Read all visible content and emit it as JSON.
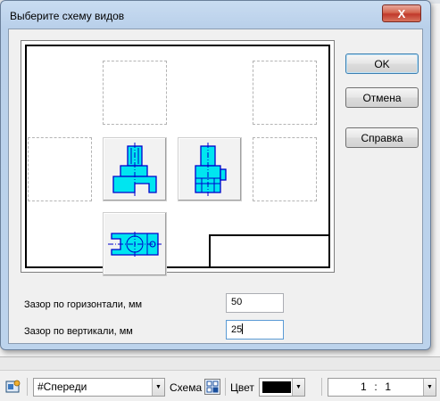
{
  "dialog": {
    "title": "Выберите схему видов",
    "close_label": "X",
    "buttons": {
      "ok": "OK",
      "cancel": "Отмена",
      "help": "Справка"
    },
    "gap_horizontal": {
      "label": "Зазор по горизонтали, мм",
      "value": "50"
    },
    "gap_vertical": {
      "label": "Зазор по вертикали, мм",
      "value": "25"
    }
  },
  "scheme": {
    "views": [
      {
        "name": "front-view",
        "state": "selected",
        "icon": "front-view-icon"
      },
      {
        "name": "left-view",
        "state": "selected",
        "icon": "left-view-icon"
      },
      {
        "name": "top-view",
        "state": "selected",
        "icon": "top-view-icon"
      }
    ],
    "accent_color": "#00e5f0",
    "outline_color": "#0000cc"
  },
  "toolbar": {
    "view_combo": "#Спереди",
    "scheme_label": "Схема",
    "color_label": "Цвет",
    "color_value": "#000000",
    "scale_left": "1",
    "scale_sep": ":",
    "scale_right": "1"
  }
}
